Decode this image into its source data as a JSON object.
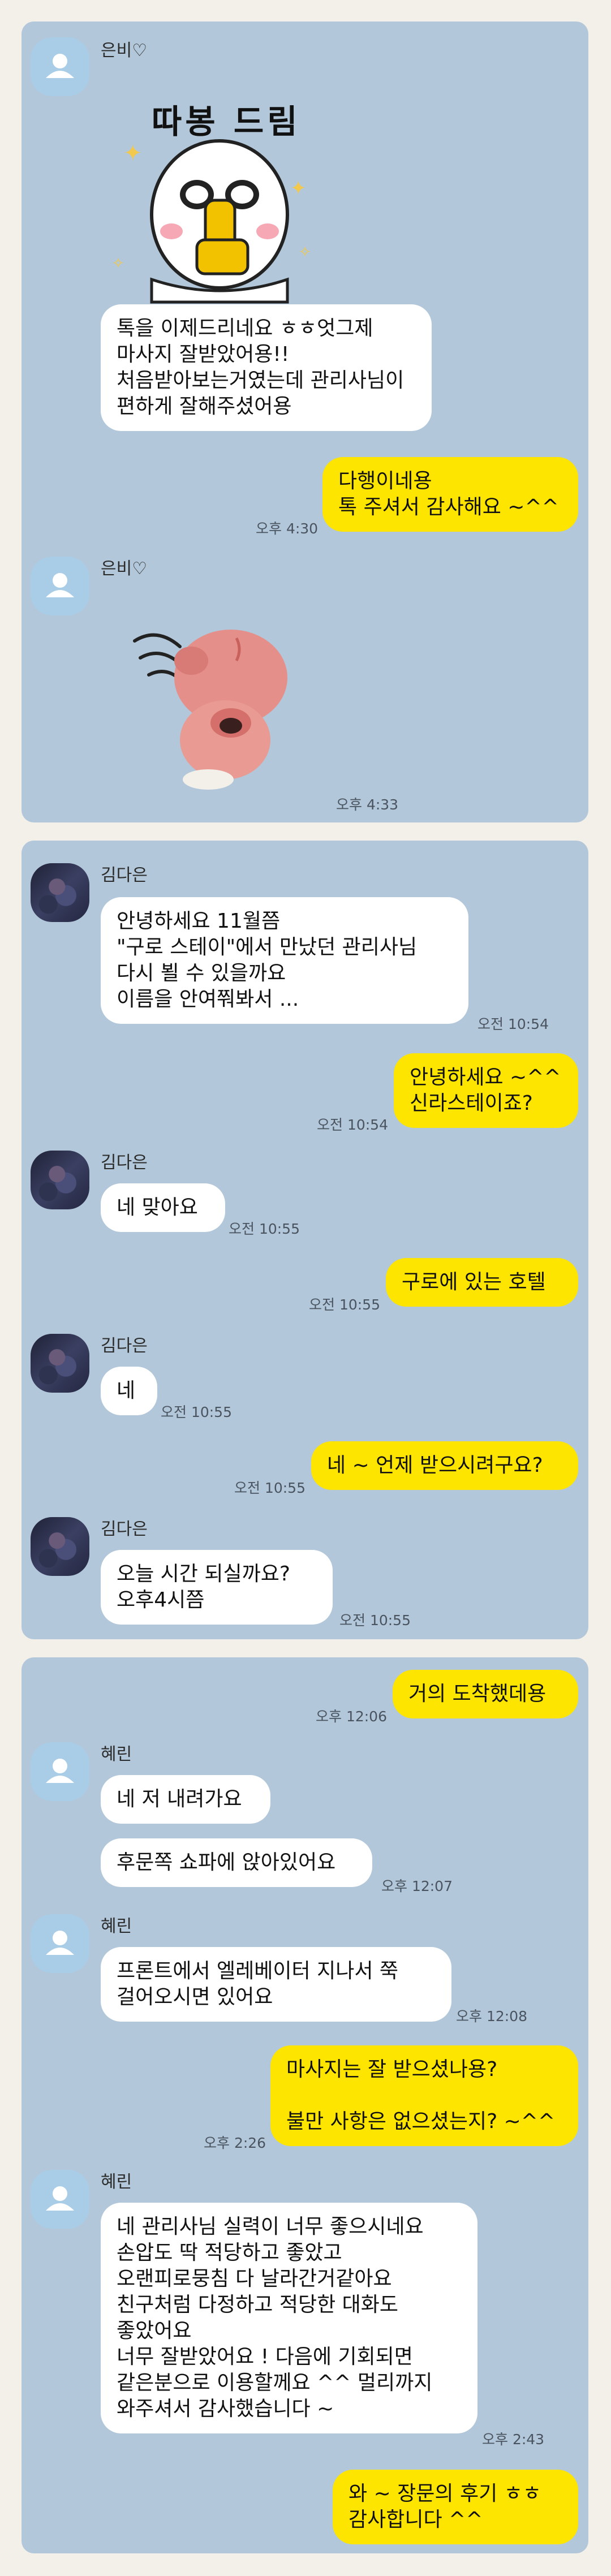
{
  "chat1": {
    "sender": "은비♡",
    "sticker_text": "따봉 드림",
    "msg1": "톡을 이제드리네요 ㅎㅎ엇그제\n마사지 잘받았어용!!\n처음받아보는거였는데 관리사님이\n편하게 잘해주셨어용",
    "reply1": "다행이네용\n톡 주셔서 감사해요 ~^^",
    "reply1_time": "오후 4:30",
    "sender2": "은비♡",
    "sticker2_time": "오후 4:33"
  },
  "chat2": {
    "sender": "김다은",
    "msg1": "안녕하세요 11월쯤\n\"구로 스테이\"에서 만났던 관리사님\n다시 뵐 수 있을까요\n이름을 안여쭤봐서 ...",
    "msg1_time": "오전 10:54",
    "reply1": "안녕하세요 ~^^\n신라스테이죠?",
    "reply1_time": "오전 10:54",
    "sender2": "김다은",
    "msg2": "네 맞아요",
    "msg2_time": "오전 10:55",
    "reply2": "구로에 있는 호텔",
    "reply2_time": "오전 10:55",
    "sender3": "김다은",
    "msg3": "네",
    "msg3_time": "오전 10:55",
    "reply3": "네 ~ 언제 받으시려구요?",
    "reply3_time": "오전 10:55",
    "sender4": "김다은",
    "msg4": "오늘  시간 되실까요?\n오후4시쯤",
    "msg4_time": "오전 10:55"
  },
  "chat3": {
    "reply1": "거의 도착했데용",
    "reply1_time": "오후 12:06",
    "sender": "혜린",
    "msg1": "네 저 내려가요",
    "msg2": "후문쪽 쇼파에 앉아있어요",
    "msg2_time": "오후 12:07",
    "sender2": "혜린",
    "msg3": "프론트에서 엘레베이터 지나서 쭉\n걸어오시면 있어요",
    "msg3_time": "오후 12:08",
    "reply2": "마사지는 잘 받으셨나용?\n\n불만 사항은 없으셨는지? ~^^",
    "reply2_time": "오후 2:26",
    "sender3": "혜린",
    "msg4": "네 관리사님 실력이 너무 좋으시네요\n손압도 딱 적당하고 좋았고\n오랜피로뭉침 다 날라간거같아요\n친구처럼 다정하고 적당한 대화도\n좋았어요\n너무 잘받았어요 ! 다음에 기회되면\n같은분으로 이용할께요 ^^ 멀리까지\n와주셔서 감사했습니다 ~",
    "msg4_time": "오후 2:43",
    "reply3": "와 ~ 장문의 후기 ㅎㅎ\n감사합니다 ^^"
  },
  "colors": {
    "chat_bg": "#b2c7d9",
    "page_bg": "#f3efe9",
    "my_bubble": "#fee500",
    "their_bubble": "#ffffff"
  }
}
